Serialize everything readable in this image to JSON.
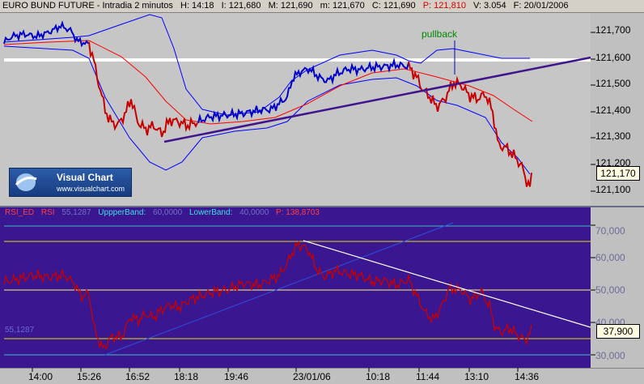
{
  "header": {
    "symbol": "EURO BUND FUTURE - Intradia 2 minutos",
    "high": "H: 14:18",
    "h2": "I: 121,680",
    "m": "M: 121,690",
    "m2": "m: 121,670",
    "close": "C: 121,690",
    "p": "P: 121,810",
    "v": "V: 3.054",
    "f": "F: 20/01/2006"
  },
  "price_axis": {
    "labels": [
      "121,700",
      "121,600",
      "121,500",
      "121,400",
      "121,300",
      "121,200",
      "121,100"
    ],
    "current": "121,170"
  },
  "rsi": {
    "title": "RSI_ED",
    "name": "RSI",
    "value": "55,1287",
    "upper_label": "UppperBand:",
    "upper_value": "60,0000",
    "lower_label": "LowerBand:",
    "lower_value": "40,0000",
    "p_value": "P: 138,8703",
    "left_marker": "55,1287",
    "axis_labels": [
      "70,000",
      "60,000",
      "50,000",
      "40,000",
      "30,000"
    ],
    "current": "37,900"
  },
  "time_axis": [
    "14:00",
    "15:26",
    "16:52",
    "18:18",
    "19:46",
    "23/01/06",
    "10:18",
    "11:44",
    "13:10",
    "14:36"
  ],
  "annotation": "pullback",
  "logo": {
    "title": "Visual Chart",
    "url": "www.visualchart.com",
    "icon": "globe-swoosh-icon"
  },
  "colors": {
    "price": "#0000c8",
    "price_down": "#c80000",
    "ma": "#ff0000",
    "bands": "#0000ff",
    "trendline": "#40148c",
    "rsi": "#c80000",
    "rsi_panel": "#3a1690"
  }
}
